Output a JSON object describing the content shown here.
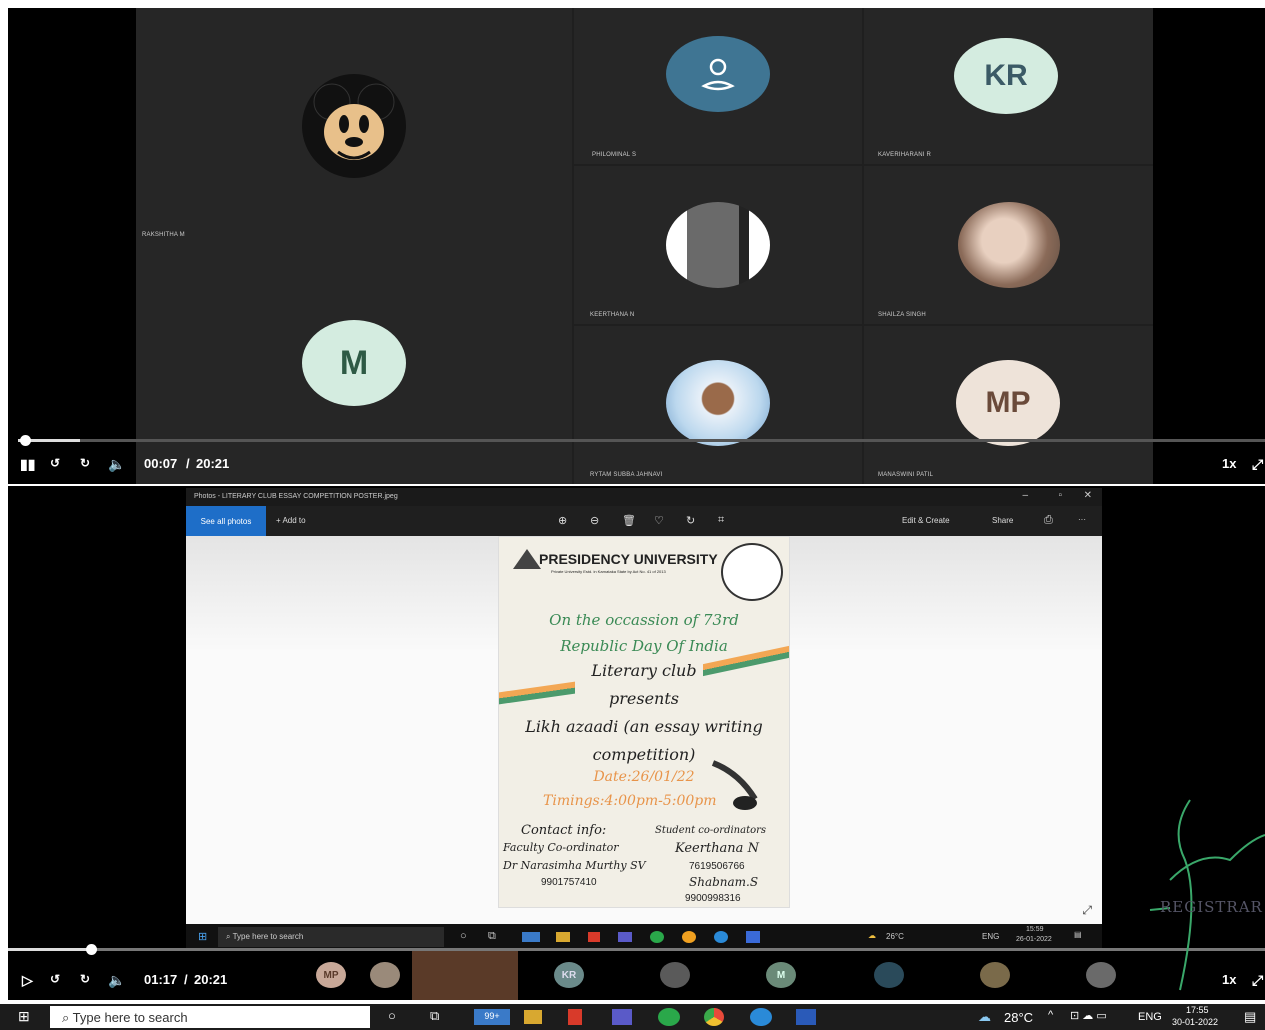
{
  "video1": {
    "participants": [
      {
        "initials": "",
        "name": "RAKSHITHA M",
        "kind": "mickey"
      },
      {
        "initials": "",
        "name": "PHILOMINAL S",
        "kind": "generic"
      },
      {
        "initials": "KR",
        "name": "KAVERIHARANI R",
        "kind": "initials"
      },
      {
        "initials": "M",
        "name": "",
        "kind": "initials"
      },
      {
        "initials": "",
        "name": "KEERTHANA N",
        "kind": "photo"
      },
      {
        "initials": "",
        "name": "SHAILZA SINGH",
        "kind": "photo"
      },
      {
        "initials": "",
        "name": "RYTAM SUBBA JAHNAVI",
        "kind": "photo"
      },
      {
        "initials": "MP",
        "name": "MANASWINI PATIL",
        "kind": "initials"
      }
    ],
    "time_current": "00:07",
    "time_sep": "/",
    "time_total": "20:21",
    "speed": "1x",
    "progress": 0.006
  },
  "photos_app": {
    "title": "Photos - LITERARY CLUB ESSAY COMPETITION POSTER.jpeg",
    "see_all": "See all photos",
    "add_to": "+ Add to",
    "edit_create": "Edit & Create",
    "share": "Share",
    "more": "···",
    "poster": {
      "university": "PRESIDENCY UNIVERSITY",
      "subline": "Private University Estd. in Karnataka State by Act No. 41 of 2013",
      "line1": "On the occassion of 73rd",
      "line2": "Republic Day Of India",
      "line3": "Literary club",
      "line4": "presents",
      "line5": "Likh azaadi (an essay writing",
      "line6": "competition)",
      "date": "Date:26/01/22",
      "timings": "Timings:4:00pm-5:00pm",
      "contact_label": "Contact info:",
      "faculty_label": "Faculty Co-ordinator",
      "faculty_name": "Dr Narasimha Murthy SV",
      "faculty_phone": "9901757410",
      "student_label": "Student co-ordinators",
      "student1": "Keerthana N",
      "student1_phone": "7619506766",
      "student2": "Shabnam.S",
      "student2_phone": "9900998316"
    },
    "inner_taskbar": {
      "search": "Type here to search",
      "weather": "26°C",
      "lang": "ENG",
      "time": "15:59",
      "date": "26-01-2022"
    }
  },
  "video2": {
    "time_current": "01:17",
    "time_sep": "/",
    "time_total": "20:21",
    "speed": "1x",
    "progress": 0.063,
    "thumb_initials": [
      "MP",
      "KR",
      "M"
    ]
  },
  "taskbar": {
    "search_placeholder": "Type here to search",
    "weather": "28°C",
    "lang": "ENG",
    "time": "17:55",
    "date": "30-01-2022",
    "badge": "99+"
  },
  "stamp": "REGISTRAR",
  "colors": {
    "avatar_teal": "#3f7593",
    "avatar_mint": "#d4ece0",
    "avatar_beige": "#eee3d9",
    "green_text": "#3a8a55",
    "orange_text": "#e8944a"
  }
}
